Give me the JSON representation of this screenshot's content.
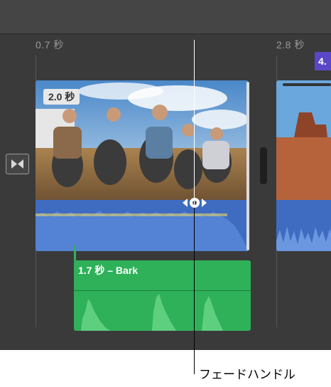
{
  "timeline": {
    "ruler_times": [
      "0.7 秒",
      "2.8 秒"
    ],
    "main_clip": {
      "duration_label": "2.0 秒"
    },
    "next_clip": {
      "duration_label": "4."
    },
    "audio_clip": {
      "label": "1.7 秒 – Bark"
    }
  },
  "callout": {
    "label": "フェードハンドル"
  },
  "colors": {
    "video_waveform": "#3f6cc0",
    "audio_clip": "#2fb15a",
    "next_clip_marker": "#5a47c7",
    "panel_background": "#3a3a3a"
  }
}
